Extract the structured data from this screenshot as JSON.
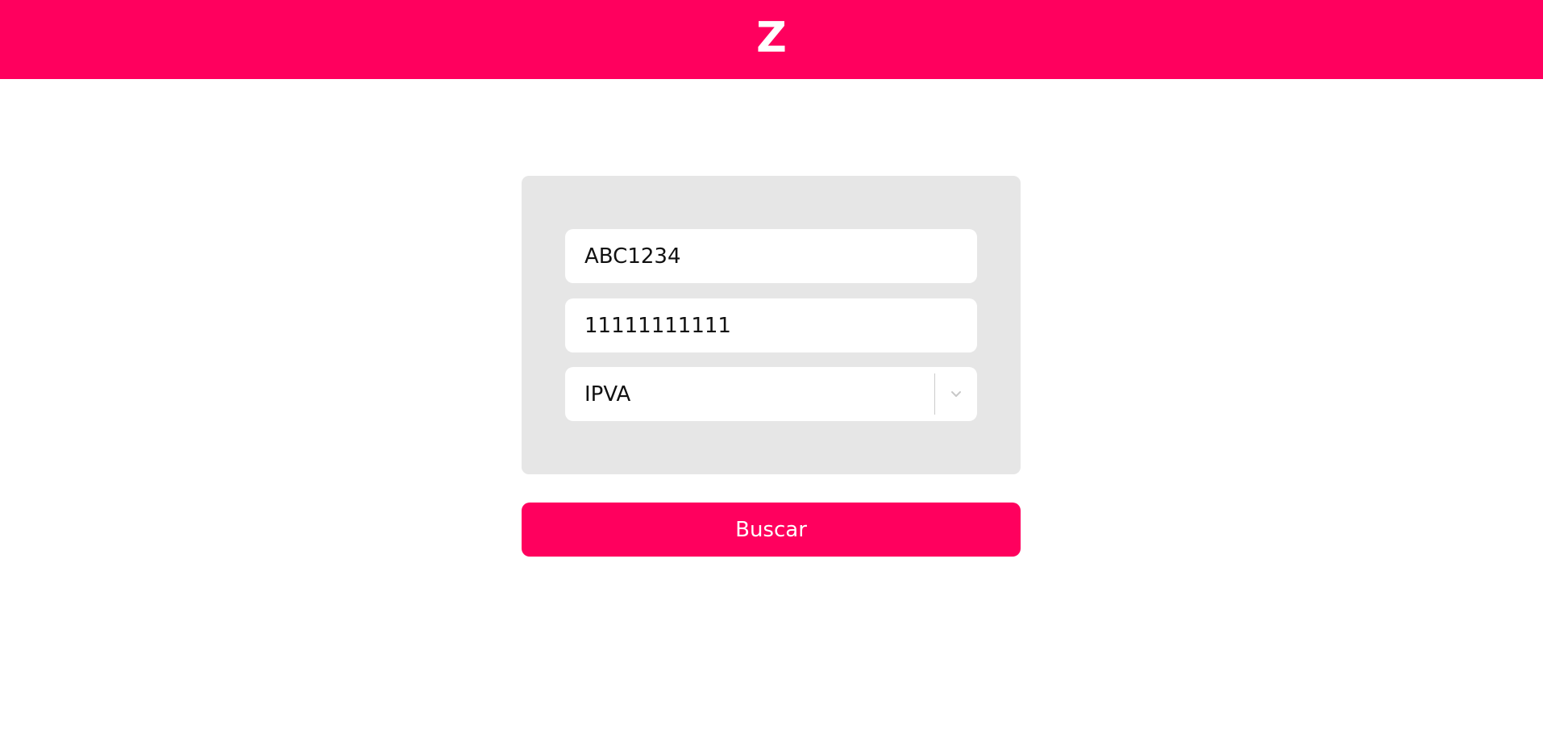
{
  "header": {
    "logo_text": "Z",
    "background_color": "#ff005e"
  },
  "form": {
    "plate_value": "ABC1234",
    "renavam_value": "11111111111",
    "service_select": {
      "selected": "IPVA",
      "icon": "chevron-down-icon"
    }
  },
  "actions": {
    "search_label": "Buscar",
    "accent_color": "#ff005e"
  }
}
